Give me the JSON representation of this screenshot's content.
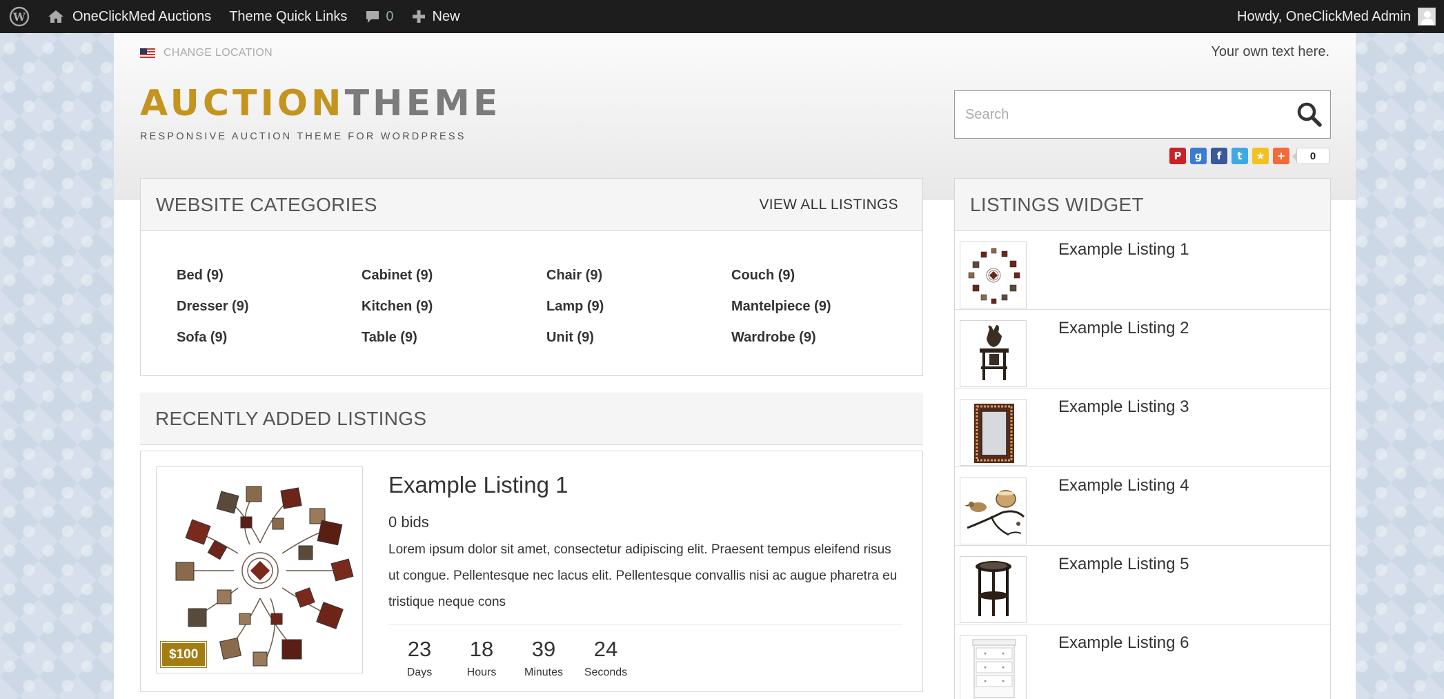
{
  "adminbar": {
    "site_name": "OneClickMed Auctions",
    "quick_links": "Theme Quick Links",
    "comment_count": "0",
    "new_label": "New",
    "howdy": "Howdy, OneClickMed Admin"
  },
  "header": {
    "change_location": "CHANGE LOCATION",
    "own_text": "Your own text here.",
    "logo_part1": "AUCTION",
    "logo_part2": "THEME",
    "tagline": "RESPONSIVE AUCTION THEME FOR WORDPRESS",
    "search_placeholder": "Search",
    "share_count": "0"
  },
  "categories": {
    "title": "WEBSITE CATEGORIES",
    "view_all": "VIEW ALL LISTINGS",
    "items": [
      "Bed (9)",
      "Cabinet (9)",
      "Chair (9)",
      "Couch (9)",
      "Dresser (9)",
      "Kitchen (9)",
      "Lamp (9)",
      "Mantelpiece (9)",
      "Sofa (9)",
      "Table (9)",
      "Unit (9)",
      "Wardrobe (9)"
    ]
  },
  "recent": {
    "title": "RECENTLY ADDED LISTINGS",
    "listing": {
      "title": "Example Listing 1",
      "price": "$100",
      "bids": "0 bids",
      "description": "Lorem ipsum dolor sit amet, consectetur adipiscing elit. Praesent tempus eleifend risus ut congue. Pellentesque nec lacus elit. Pellentesque convallis nisi ac augue pharetra eu tristique neque cons",
      "countdown": [
        {
          "value": "23",
          "label": "Days"
        },
        {
          "value": "18",
          "label": "Hours"
        },
        {
          "value": "39",
          "label": "Minutes"
        },
        {
          "value": "24",
          "label": "Seconds"
        }
      ]
    }
  },
  "widget": {
    "title": "LISTINGS WIDGET",
    "items": [
      {
        "title": "Example Listing 1",
        "image": "wall-art"
      },
      {
        "title": "Example Listing 2",
        "image": "side-table-sculpture"
      },
      {
        "title": "Example Listing 3",
        "image": "mirror"
      },
      {
        "title": "Example Listing 4",
        "image": "bird-candle-holder"
      },
      {
        "title": "Example Listing 5",
        "image": "round-side-table"
      },
      {
        "title": "Example Listing 6",
        "image": "white-dresser"
      }
    ]
  },
  "colors": {
    "logo_gold": "#c4941f",
    "logo_gray": "#7b7b7b",
    "price_tag": "#a47c12",
    "adminbar": "#1d1d1d"
  }
}
